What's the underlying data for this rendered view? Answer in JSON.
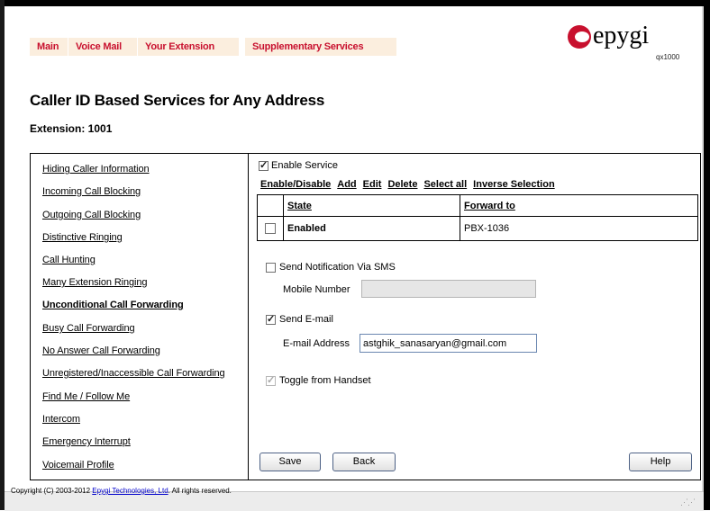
{
  "nav": [
    "Main",
    "Voice Mail",
    "Your Extension",
    "Supplementary Services"
  ],
  "logo": {
    "text": "epygi",
    "model": "qx1000",
    "brand_color": "#c8102e"
  },
  "page_title": "Caller ID Based Services for Any Address",
  "extension_label": "Extension: 1001",
  "sidebar": {
    "items": [
      "Hiding Caller Information",
      "Incoming Call Blocking",
      "Outgoing Call Blocking",
      "Distinctive Ringing",
      "Call Hunting",
      "Many Extension Ringing",
      "Unconditional Call Forwarding",
      "Busy Call Forwarding",
      "No Answer Call Forwarding",
      "Unregistered/Inaccessible Call Forwarding",
      "Find Me / Follow Me",
      "Intercom",
      "Emergency Interrupt",
      "Voicemail Profile"
    ],
    "active_index": 6
  },
  "service": {
    "enable_label": "Enable Service",
    "enabled": true,
    "actions": [
      "Enable/Disable",
      "Add",
      "Edit",
      "Delete",
      "Select all",
      "Inverse Selection"
    ],
    "table": {
      "headers": [
        "State",
        "Forward to"
      ],
      "rows": [
        {
          "state": "Enabled",
          "forward_to": "PBX-1036",
          "selected": false
        }
      ]
    }
  },
  "sms": {
    "label": "Send Notification Via SMS",
    "checked": false,
    "mobile_label": "Mobile Number",
    "mobile_value": ""
  },
  "email": {
    "label": "Send E-mail",
    "checked": true,
    "address_label": "E-mail Address",
    "address_value": "astghik_sanasaryan@gmail.com"
  },
  "toggle": {
    "label": "Toggle from Handset",
    "checked": true,
    "disabled": true
  },
  "buttons": {
    "save": "Save",
    "back": "Back",
    "help": "Help"
  },
  "footer": {
    "prefix": "Copyright (C) 2003-2012 ",
    "link": "Epygi Technologies, Ltd",
    "suffix": ". All rights reserved."
  }
}
